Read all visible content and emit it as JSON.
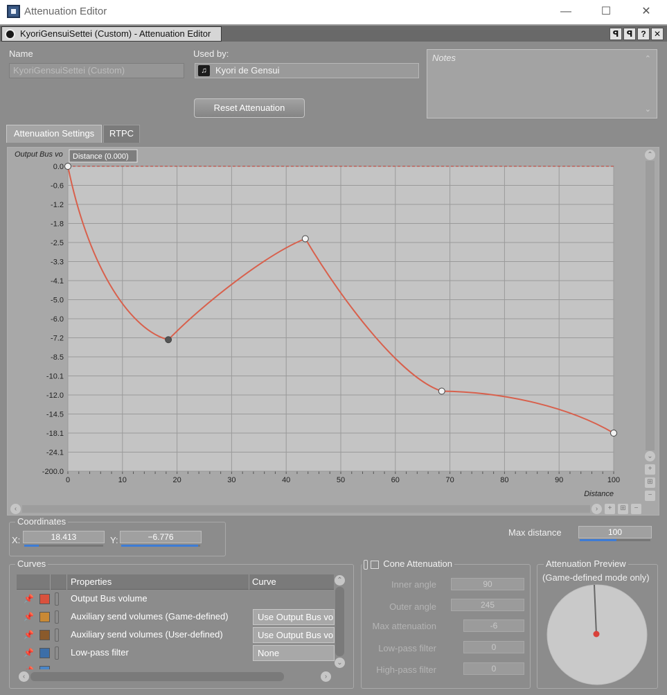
{
  "window": {
    "title": "Attenuation Editor",
    "minimize": "—",
    "maximize": "☐",
    "close": "✕"
  },
  "editor_tab": {
    "label": "KyoriGensuiSettei (Custom) - Attenuation Editor",
    "buttons": [
      "ꟼ",
      "ꟼ",
      "?",
      "✕"
    ]
  },
  "name": {
    "label": "Name",
    "value": "KyoriGensuiSettei (Custom)"
  },
  "used_by": {
    "label": "Used by:",
    "value": "Kyori de Gensui"
  },
  "notes": {
    "placeholder": "Notes"
  },
  "reset_button": "Reset Attenuation",
  "tabs": [
    {
      "label": "Attenuation Settings",
      "active": true
    },
    {
      "label": "RTPC",
      "active": false
    }
  ],
  "graph": {
    "ylabel": "Output Bus vo",
    "xlabel": "Distance",
    "tooltip": "Distance (0.000)",
    "y_ticks": [
      "0.0",
      "-0.6",
      "-1.2",
      "-1.8",
      "-2.5",
      "-3.3",
      "-4.1",
      "-5.0",
      "-6.0",
      "-7.2",
      "-8.5",
      "-10.1",
      "-12.0",
      "-14.5",
      "-18.1",
      "-24.1",
      "-200.0"
    ],
    "x_ticks": [
      "0",
      "10",
      "20",
      "30",
      "40",
      "50",
      "60",
      "70",
      "80",
      "90",
      "100"
    ],
    "curve_color": "#d8604c",
    "points": [
      {
        "x": 0,
        "tick_index": 0,
        "selected": false
      },
      {
        "x": 18.413,
        "tick_index": 9.1,
        "selected": true
      },
      {
        "x": 43.5,
        "tick_index": 3.8,
        "selected": false
      },
      {
        "x": 68.5,
        "tick_index": 11.8,
        "selected": false
      },
      {
        "x": 100,
        "tick_index": 14.0,
        "selected": false
      }
    ]
  },
  "coordinates": {
    "title": "Coordinates",
    "x_label": "X:",
    "x_value": "18.413",
    "y_label": "Y:",
    "y_value": "−6.776"
  },
  "max_distance": {
    "label": "Max distance",
    "value": "100"
  },
  "curves": {
    "title": "Curves",
    "header_properties": "Properties",
    "header_curve": "Curve",
    "rows": [
      {
        "name": "Output Bus volume",
        "color": "#d9513d",
        "curve": ""
      },
      {
        "name": "Auxiliary send volumes (Game-defined)",
        "color": "#c98935",
        "curve": "Use Output Bus vo"
      },
      {
        "name": "Auxiliary send volumes (User-defined)",
        "color": "#8a5a2b",
        "curve": "Use Output Bus vo"
      },
      {
        "name": "Low-pass filter",
        "color": "#3c6ea8",
        "curve": "None"
      }
    ]
  },
  "cone": {
    "title": "Cone Attenuation",
    "inner_label": "Inner angle",
    "inner_value": "90",
    "outer_label": "Outer angle",
    "outer_value": "245",
    "max_att_label": "Max attenuation",
    "max_att_value": "-6",
    "lowpass_label": "Low-pass filter",
    "lowpass_value": "0",
    "highpass_label": "High-pass filter",
    "highpass_value": "0"
  },
  "preview": {
    "title": "Attenuation Preview",
    "subtitle": "(Game-defined mode only)",
    "dot_color": "#d9413a"
  }
}
